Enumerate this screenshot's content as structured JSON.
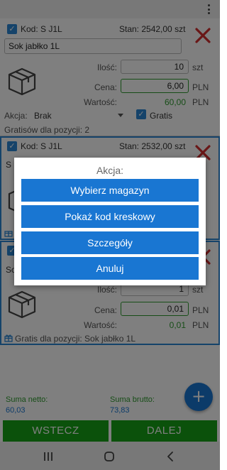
{
  "card1": {
    "kod": "Kod: S J1L",
    "stan": "Stan: 2542,00 szt",
    "name": "Sok jabłko 1L",
    "ilosc_label": "Ilość:",
    "ilosc_value": "10",
    "ilosc_unit": "szt",
    "cena_label": "Cena:",
    "cena_value": "6,00",
    "cena_unit": "PLN",
    "wartosc_label": "Wartość:",
    "wartosc_value": "60,00",
    "wartosc_unit": "PLN",
    "akcja_label": "Akcja:",
    "akcja_value": "Brak",
    "gratis_label": "Gratis",
    "gratisow": "Gratisów dla pozycji: 2"
  },
  "card2": {
    "kod": "Kod: S J1L",
    "stan": "Stan: 2532,00 szt",
    "name_fragment": "S"
  },
  "card3": {
    "name_fragment": "So",
    "ilosc_label": "Ilość:",
    "ilosc_value": "1",
    "ilosc_unit": "szt",
    "cena_label": "Cena:",
    "cena_value": "0,01",
    "cena_unit": "PLN",
    "wartosc_label": "Wartość:",
    "wartosc_value": "0,01",
    "wartosc_unit": "PLN",
    "gratis_text": "Gratis dla pozycji: Sok jabłko 1L"
  },
  "dialog": {
    "title": "Akcja:",
    "buttons": [
      "Wybierz magazyn",
      "Pokaż kod kreskowy",
      "Szczegóły",
      "Anuluj"
    ]
  },
  "summary": {
    "netto_label": "Suma netto:",
    "netto_value": "60,03",
    "brutto_label": "Suma brutto:",
    "brutto_value": "73,83",
    "fab_symbol": "+"
  },
  "nav": {
    "back_label": "WSTECZ",
    "next_label": "DALEJ"
  },
  "colors": {
    "accent_blue": "#1976d2",
    "green": "#17a317",
    "delete_red": "#d32f2f"
  },
  "icons": [
    "kebab-menu-icon",
    "checkbox-checked-icon",
    "delete-x-icon",
    "box-icon",
    "gift-icon",
    "plus-icon",
    "recents-icon",
    "home-icon",
    "back-icon"
  ]
}
